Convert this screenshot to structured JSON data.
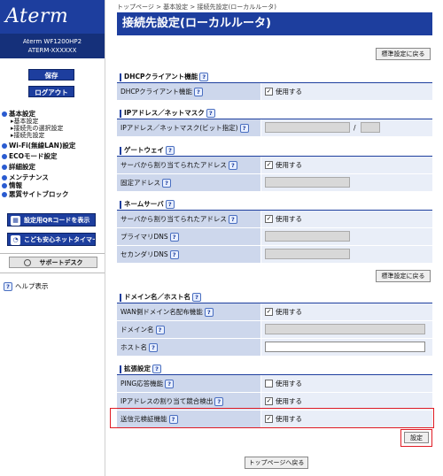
{
  "sidebar": {
    "logo": "Aterm",
    "model_line1": "Aterm WF1200HP2",
    "model_line2": "ATERM-XXXXXX",
    "save_label": "保存",
    "logout_label": "ログアウト",
    "menu": {
      "basic": "基本設定",
      "basic_sub1": "基本設定",
      "basic_sub2": "接続先の選択設定",
      "basic_sub3": "接続先設定",
      "wifi": "Wi-Fi(無線LAN)設定",
      "eco": "ECOモード設定",
      "detail": "詳細設定",
      "maintenance": "メンテナンス",
      "info": "情報",
      "malicious": "悪質サイトブロック"
    },
    "qr_label": "設定用QRコードを表示",
    "kids_label": "こども安心ネットタイマー",
    "support_label": "サポートデスク",
    "help_label": "ヘルプ表示"
  },
  "main": {
    "breadcrumb": "トップページ > 基本設定 > 接続先設定(ローカルルータ)",
    "title": "接続先設定(ローカルルータ)",
    "default_btn": "標準設定に戻る",
    "set_btn": "設定",
    "top_btn": "トップページへ戻る",
    "slash": "/",
    "dhcp": {
      "header": "DHCPクライアント機能",
      "row1": "DHCPクライアント機能",
      "row1_val": "使用する"
    },
    "ip": {
      "header": "IPアドレス／ネットマスク",
      "row1": "IPアドレス／ネットマスク(ビット指定)"
    },
    "gw": {
      "header": "ゲートウェイ",
      "row1": "サーバから割り当てられたアドレス",
      "row1_val": "使用する",
      "row2": "固定アドレス"
    },
    "ns": {
      "header": "ネームサーバ",
      "row1": "サーバから割り当てられたアドレス",
      "row1_val": "使用する",
      "row2": "プライマリDNS",
      "row3": "セカンダリDNS"
    },
    "domain": {
      "header": "ドメイン名／ホスト名",
      "row1": "WAN側ドメイン名配布機能",
      "row1_val": "使用する",
      "row2": "ドメイン名",
      "row3": "ホスト名"
    },
    "ext": {
      "header": "拡張設定",
      "row1": "PING応答機能",
      "row1_val": "使用する",
      "row2": "IPアドレスの割り当て競合検出",
      "row2_val": "使用する",
      "row3": "送信元検証機能",
      "row3_val": "使用する"
    }
  }
}
